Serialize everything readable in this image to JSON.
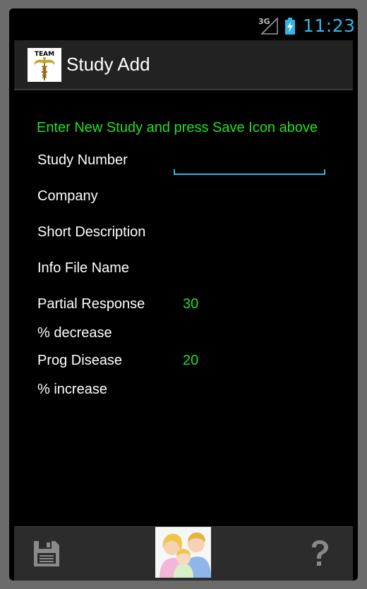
{
  "status_bar": {
    "network": "3G",
    "time": "11:23",
    "battery_icon": "battery-charging-icon"
  },
  "action_bar": {
    "logo_text": "TEAM",
    "title": "Study Add"
  },
  "form": {
    "instruction": "Enter New Study and press Save Icon above",
    "study_number_label": "Study Number",
    "study_number_value": "",
    "company_label": "Company",
    "short_description_label": "Short Description",
    "info_file_name_label": "Info File Name",
    "partial_response_label": "Partial Response",
    "partial_response_value": "30",
    "decrease_label": "% decrease",
    "prog_disease_label": "Prog Disease",
    "prog_disease_value": "20",
    "increase_label": "% increase"
  },
  "bottom_bar": {
    "save_icon": "save-floppy-icon",
    "image": "family-image",
    "help_icon": "help-question-icon"
  },
  "colors": {
    "accent": "#33b5e5",
    "value_green": "#22e022",
    "background": "#000000",
    "bar": "#222222"
  }
}
